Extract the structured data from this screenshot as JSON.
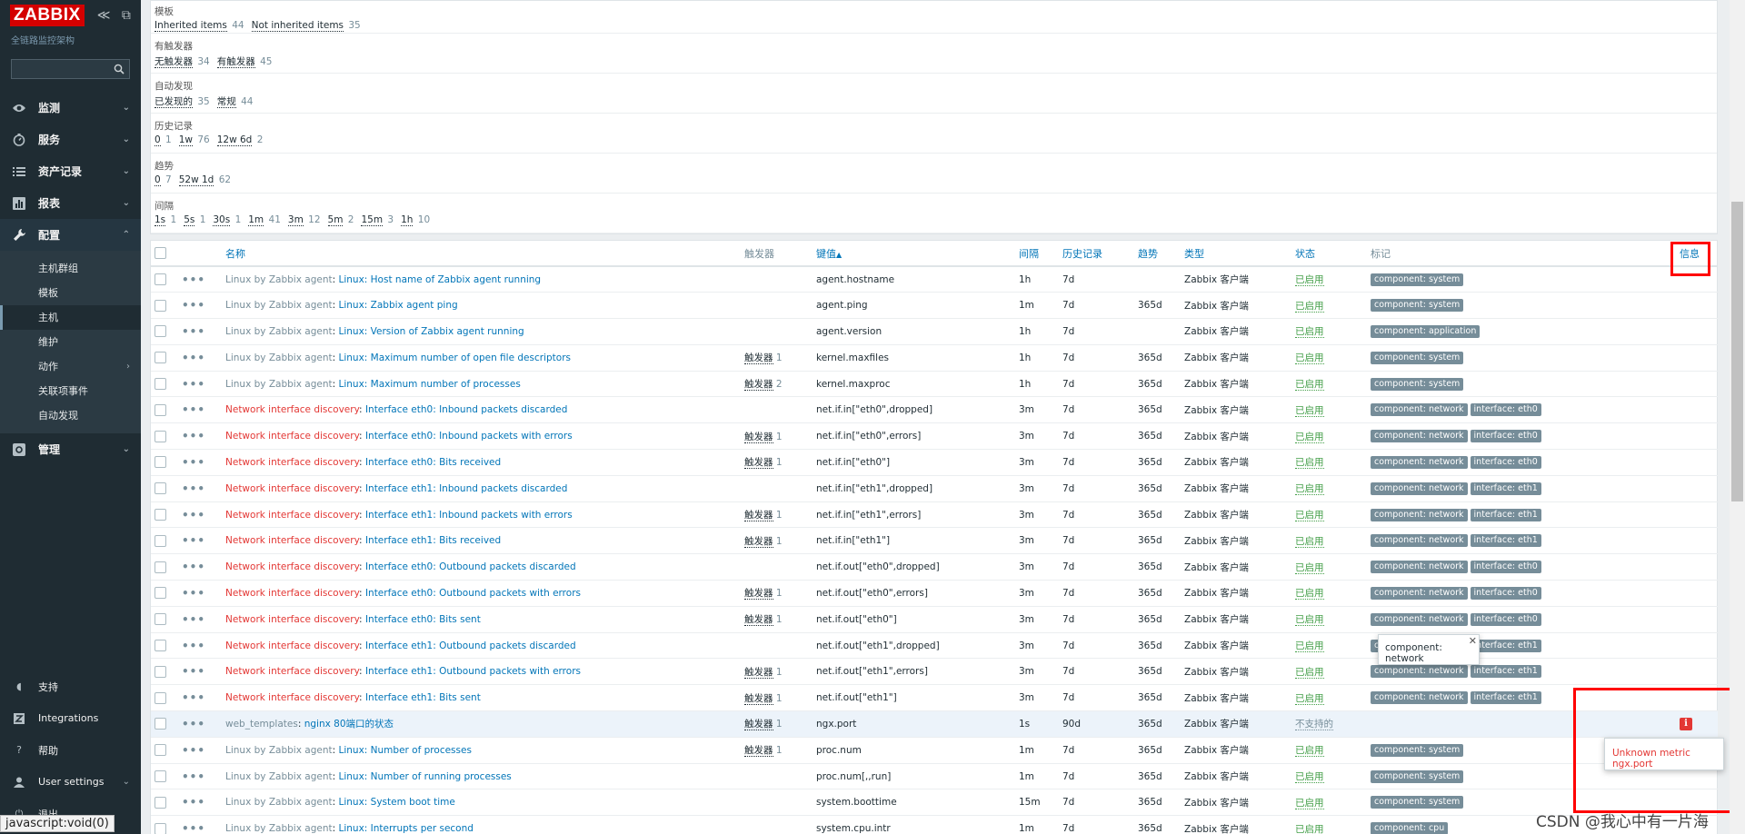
{
  "sidebar": {
    "logo": "ZABBIX",
    "subtitle": "全链路监控架构",
    "collapse_icons": "≪ ⧉",
    "search_value": "",
    "menu": [
      {
        "label": "监测",
        "icon": "eye-icon"
      },
      {
        "label": "服务",
        "icon": "clock-icon"
      },
      {
        "label": "资产记录",
        "icon": "list-icon"
      },
      {
        "label": "报表",
        "icon": "chart-icon"
      },
      {
        "label": "配置",
        "icon": "wrench-icon"
      }
    ],
    "config_submenu": [
      "主机群组",
      "模板",
      "主机",
      "维护",
      "动作",
      "关联项事件",
      "自动发现"
    ],
    "admin": {
      "label": "管理",
      "icon": "gear-icon"
    },
    "bottom": [
      {
        "label": "支持",
        "icon": "headset-icon"
      },
      {
        "label": "Integrations",
        "icon": "z-icon"
      },
      {
        "label": "帮助",
        "icon": "help-icon"
      },
      {
        "label": "User settings",
        "icon": "user-icon"
      },
      {
        "label": "退出",
        "icon": "power-icon"
      }
    ]
  },
  "filters": [
    {
      "label": "模板",
      "values": [
        [
          "Inherited items",
          "44"
        ],
        [
          "Not inherited items",
          "35"
        ]
      ]
    },
    {
      "label": "有触发器",
      "values": [
        [
          "无触发器",
          "34"
        ],
        [
          "有触发器",
          "45"
        ]
      ]
    },
    {
      "label": "自动发现",
      "values": [
        [
          "已发现的",
          "35"
        ],
        [
          "常规",
          "44"
        ]
      ]
    },
    {
      "label": "历史记录",
      "values": [
        [
          "0",
          "1"
        ],
        [
          "1w",
          "76"
        ],
        [
          "12w 6d",
          "2"
        ]
      ]
    },
    {
      "label": "趋势",
      "values": [
        [
          "0",
          "7"
        ],
        [
          "52w 1d",
          "62"
        ]
      ]
    },
    {
      "label": "间隔",
      "values": [
        [
          "1s",
          "1"
        ],
        [
          "5s",
          "1"
        ],
        [
          "30s",
          "1"
        ],
        [
          "1m",
          "41"
        ],
        [
          "3m",
          "12"
        ],
        [
          "5m",
          "2"
        ],
        [
          "15m",
          "3"
        ],
        [
          "1h",
          "10"
        ]
      ]
    }
  ],
  "table": {
    "headers": {
      "name": "名称",
      "triggers": "触发器",
      "key": "键值",
      "key_sort": "▲",
      "interval": "间隔",
      "history": "历史记录",
      "trends": "趋势",
      "type": "类型",
      "status": "状态",
      "tags": "标记",
      "info": "信息"
    },
    "rows": [
      {
        "tmpl": "Linux by Zabbix agent",
        "tc": "g",
        "name": "Linux: Host name of Zabbix agent running",
        "trig": "",
        "trig_n": "",
        "key": "agent.hostname",
        "int": "1h",
        "hist": "7d",
        "trend": "",
        "type": "Zabbix 客户端",
        "status": "已启用",
        "st": "on",
        "tags": [
          "component: system"
        ]
      },
      {
        "tmpl": "Linux by Zabbix agent",
        "tc": "g",
        "name": "Linux: Zabbix agent ping",
        "trig": "",
        "trig_n": "",
        "key": "agent.ping",
        "int": "1m",
        "hist": "7d",
        "trend": "365d",
        "type": "Zabbix 客户端",
        "status": "已启用",
        "st": "on",
        "tags": [
          "component: system"
        ]
      },
      {
        "tmpl": "Linux by Zabbix agent",
        "tc": "g",
        "name": "Linux: Version of Zabbix agent running",
        "trig": "",
        "trig_n": "",
        "key": "agent.version",
        "int": "1h",
        "hist": "7d",
        "trend": "",
        "type": "Zabbix 客户端",
        "status": "已启用",
        "st": "on",
        "tags": [
          "component: application"
        ]
      },
      {
        "tmpl": "Linux by Zabbix agent",
        "tc": "g",
        "name": "Linux: Maximum number of open file descriptors",
        "trig": "触发器",
        "trig_n": "1",
        "key": "kernel.maxfiles",
        "int": "1h",
        "hist": "7d",
        "trend": "365d",
        "type": "Zabbix 客户端",
        "status": "已启用",
        "st": "on",
        "tags": [
          "component: system"
        ]
      },
      {
        "tmpl": "Linux by Zabbix agent",
        "tc": "g",
        "name": "Linux: Maximum number of processes",
        "trig": "触发器",
        "trig_n": "2",
        "key": "kernel.maxproc",
        "int": "1h",
        "hist": "7d",
        "trend": "365d",
        "type": "Zabbix 客户端",
        "status": "已启用",
        "st": "on",
        "tags": [
          "component: system"
        ]
      },
      {
        "tmpl": "Network interface discovery",
        "tc": "r",
        "name": "Interface eth0: Inbound packets discarded",
        "trig": "",
        "trig_n": "",
        "key": "net.if.in[\"eth0\",dropped]",
        "int": "3m",
        "hist": "7d",
        "trend": "365d",
        "type": "Zabbix 客户端",
        "status": "已启用",
        "st": "on",
        "tags": [
          "component: network",
          "interface: eth0"
        ]
      },
      {
        "tmpl": "Network interface discovery",
        "tc": "r",
        "name": "Interface eth0: Inbound packets with errors",
        "trig": "触发器",
        "trig_n": "1",
        "key": "net.if.in[\"eth0\",errors]",
        "int": "3m",
        "hist": "7d",
        "trend": "365d",
        "type": "Zabbix 客户端",
        "status": "已启用",
        "st": "on",
        "tags": [
          "component: network",
          "interface: eth0"
        ]
      },
      {
        "tmpl": "Network interface discovery",
        "tc": "r",
        "name": "Interface eth0: Bits received",
        "trig": "触发器",
        "trig_n": "1",
        "key": "net.if.in[\"eth0\"]",
        "int": "3m",
        "hist": "7d",
        "trend": "365d",
        "type": "Zabbix 客户端",
        "status": "已启用",
        "st": "on",
        "tags": [
          "component: network",
          "interface: eth0"
        ]
      },
      {
        "tmpl": "Network interface discovery",
        "tc": "r",
        "name": "Interface eth1: Inbound packets discarded",
        "trig": "",
        "trig_n": "",
        "key": "net.if.in[\"eth1\",dropped]",
        "int": "3m",
        "hist": "7d",
        "trend": "365d",
        "type": "Zabbix 客户端",
        "status": "已启用",
        "st": "on",
        "tags": [
          "component: network",
          "interface: eth1"
        ]
      },
      {
        "tmpl": "Network interface discovery",
        "tc": "r",
        "name": "Interface eth1: Inbound packets with errors",
        "trig": "触发器",
        "trig_n": "1",
        "key": "net.if.in[\"eth1\",errors]",
        "int": "3m",
        "hist": "7d",
        "trend": "365d",
        "type": "Zabbix 客户端",
        "status": "已启用",
        "st": "on",
        "tags": [
          "component: network",
          "interface: eth1"
        ]
      },
      {
        "tmpl": "Network interface discovery",
        "tc": "r",
        "name": "Interface eth1: Bits received",
        "trig": "触发器",
        "trig_n": "1",
        "key": "net.if.in[\"eth1\"]",
        "int": "3m",
        "hist": "7d",
        "trend": "365d",
        "type": "Zabbix 客户端",
        "status": "已启用",
        "st": "on",
        "tags": [
          "component: network",
          "interface: eth1"
        ]
      },
      {
        "tmpl": "Network interface discovery",
        "tc": "r",
        "name": "Interface eth0: Outbound packets discarded",
        "trig": "",
        "trig_n": "",
        "key": "net.if.out[\"eth0\",dropped]",
        "int": "3m",
        "hist": "7d",
        "trend": "365d",
        "type": "Zabbix 客户端",
        "status": "已启用",
        "st": "on",
        "tags": [
          "component: network",
          "interface: eth0"
        ]
      },
      {
        "tmpl": "Network interface discovery",
        "tc": "r",
        "name": "Interface eth0: Outbound packets with errors",
        "trig": "触发器",
        "trig_n": "1",
        "key": "net.if.out[\"eth0\",errors]",
        "int": "3m",
        "hist": "7d",
        "trend": "365d",
        "type": "Zabbix 客户端",
        "status": "已启用",
        "st": "on",
        "tags": [
          "component: network",
          "interface: eth0"
        ]
      },
      {
        "tmpl": "Network interface discovery",
        "tc": "r",
        "name": "Interface eth0: Bits sent",
        "trig": "触发器",
        "trig_n": "1",
        "key": "net.if.out[\"eth0\"]",
        "int": "3m",
        "hist": "7d",
        "trend": "365d",
        "type": "Zabbix 客户端",
        "status": "已启用",
        "st": "on",
        "tags": [
          "component: network",
          "interface: eth0"
        ]
      },
      {
        "tmpl": "Network interface discovery",
        "tc": "r",
        "name": "Interface eth1: Outbound packets discarded",
        "trig": "",
        "trig_n": "",
        "key": "net.if.out[\"eth1\",dropped]",
        "int": "3m",
        "hist": "7d",
        "trend": "365d",
        "type": "Zabbix 客户端",
        "status": "已启用",
        "st": "on",
        "tags": [
          "component: network",
          "interface: eth1"
        ]
      },
      {
        "tmpl": "Network interface discovery",
        "tc": "r",
        "name": "Interface eth1: Outbound packets with errors",
        "trig": "触发器",
        "trig_n": "1",
        "key": "net.if.out[\"eth1\",errors]",
        "int": "3m",
        "hist": "7d",
        "trend": "365d",
        "type": "Zabbix 客户端",
        "status": "已启用",
        "st": "on",
        "tags": [
          "component: network",
          "interface: eth1"
        ]
      },
      {
        "tmpl": "Network interface discovery",
        "tc": "r",
        "name": "Interface eth1: Bits sent",
        "trig": "触发器",
        "trig_n": "1",
        "key": "net.if.out[\"eth1\"]",
        "int": "3m",
        "hist": "7d",
        "trend": "365d",
        "type": "Zabbix 客户端",
        "status": "已启用",
        "st": "on",
        "tags": [
          "component: network",
          "interface: eth1"
        ]
      },
      {
        "tmpl": "web_templates",
        "tc": "g",
        "name": "nginx 80端口的状态",
        "trig": "触发器",
        "trig_n": "1",
        "key": "ngx.port",
        "int": "1s",
        "hist": "90d",
        "trend": "365d",
        "type": "Zabbix 客户端",
        "status": "不支持的",
        "st": "off",
        "tags": [],
        "info": true,
        "hl": true
      },
      {
        "tmpl": "Linux by Zabbix agent",
        "tc": "g",
        "name": "Linux: Number of processes",
        "trig": "触发器",
        "trig_n": "1",
        "key": "proc.num",
        "int": "1m",
        "hist": "7d",
        "trend": "365d",
        "type": "Zabbix 客户端",
        "status": "已启用",
        "st": "on",
        "tags": [
          "component: system"
        ]
      },
      {
        "tmpl": "Linux by Zabbix agent",
        "tc": "g",
        "name": "Linux: Number of running processes",
        "trig": "",
        "trig_n": "",
        "key": "proc.num[,,run]",
        "int": "1m",
        "hist": "7d",
        "trend": "365d",
        "type": "Zabbix 客户端",
        "status": "已启用",
        "st": "on",
        "tags": [
          "component: system"
        ]
      },
      {
        "tmpl": "Linux by Zabbix agent",
        "tc": "g",
        "name": "Linux: System boot time",
        "trig": "",
        "trig_n": "",
        "key": "system.boottime",
        "int": "15m",
        "hist": "7d",
        "trend": "365d",
        "type": "Zabbix 客户端",
        "status": "已启用",
        "st": "on",
        "tags": [
          "component: system"
        ]
      },
      {
        "tmpl": "Linux by Zabbix agent",
        "tc": "g",
        "name": "Linux: Interrupts per second",
        "trig": "",
        "trig_n": "",
        "key": "system.cpu.intr",
        "int": "1m",
        "hist": "7d",
        "trend": "365d",
        "type": "Zabbix 客户端",
        "status": "已启用",
        "st": "on",
        "tags": [
          "component: cpu"
        ]
      }
    ]
  },
  "tag_tooltip": {
    "text": "component: network",
    "close": "✕"
  },
  "info_tooltip": {
    "text": "Unknown metric ngx.port"
  },
  "browser_status": "javascript:void(0)",
  "watermark": "CSDN @我心中有一片海"
}
